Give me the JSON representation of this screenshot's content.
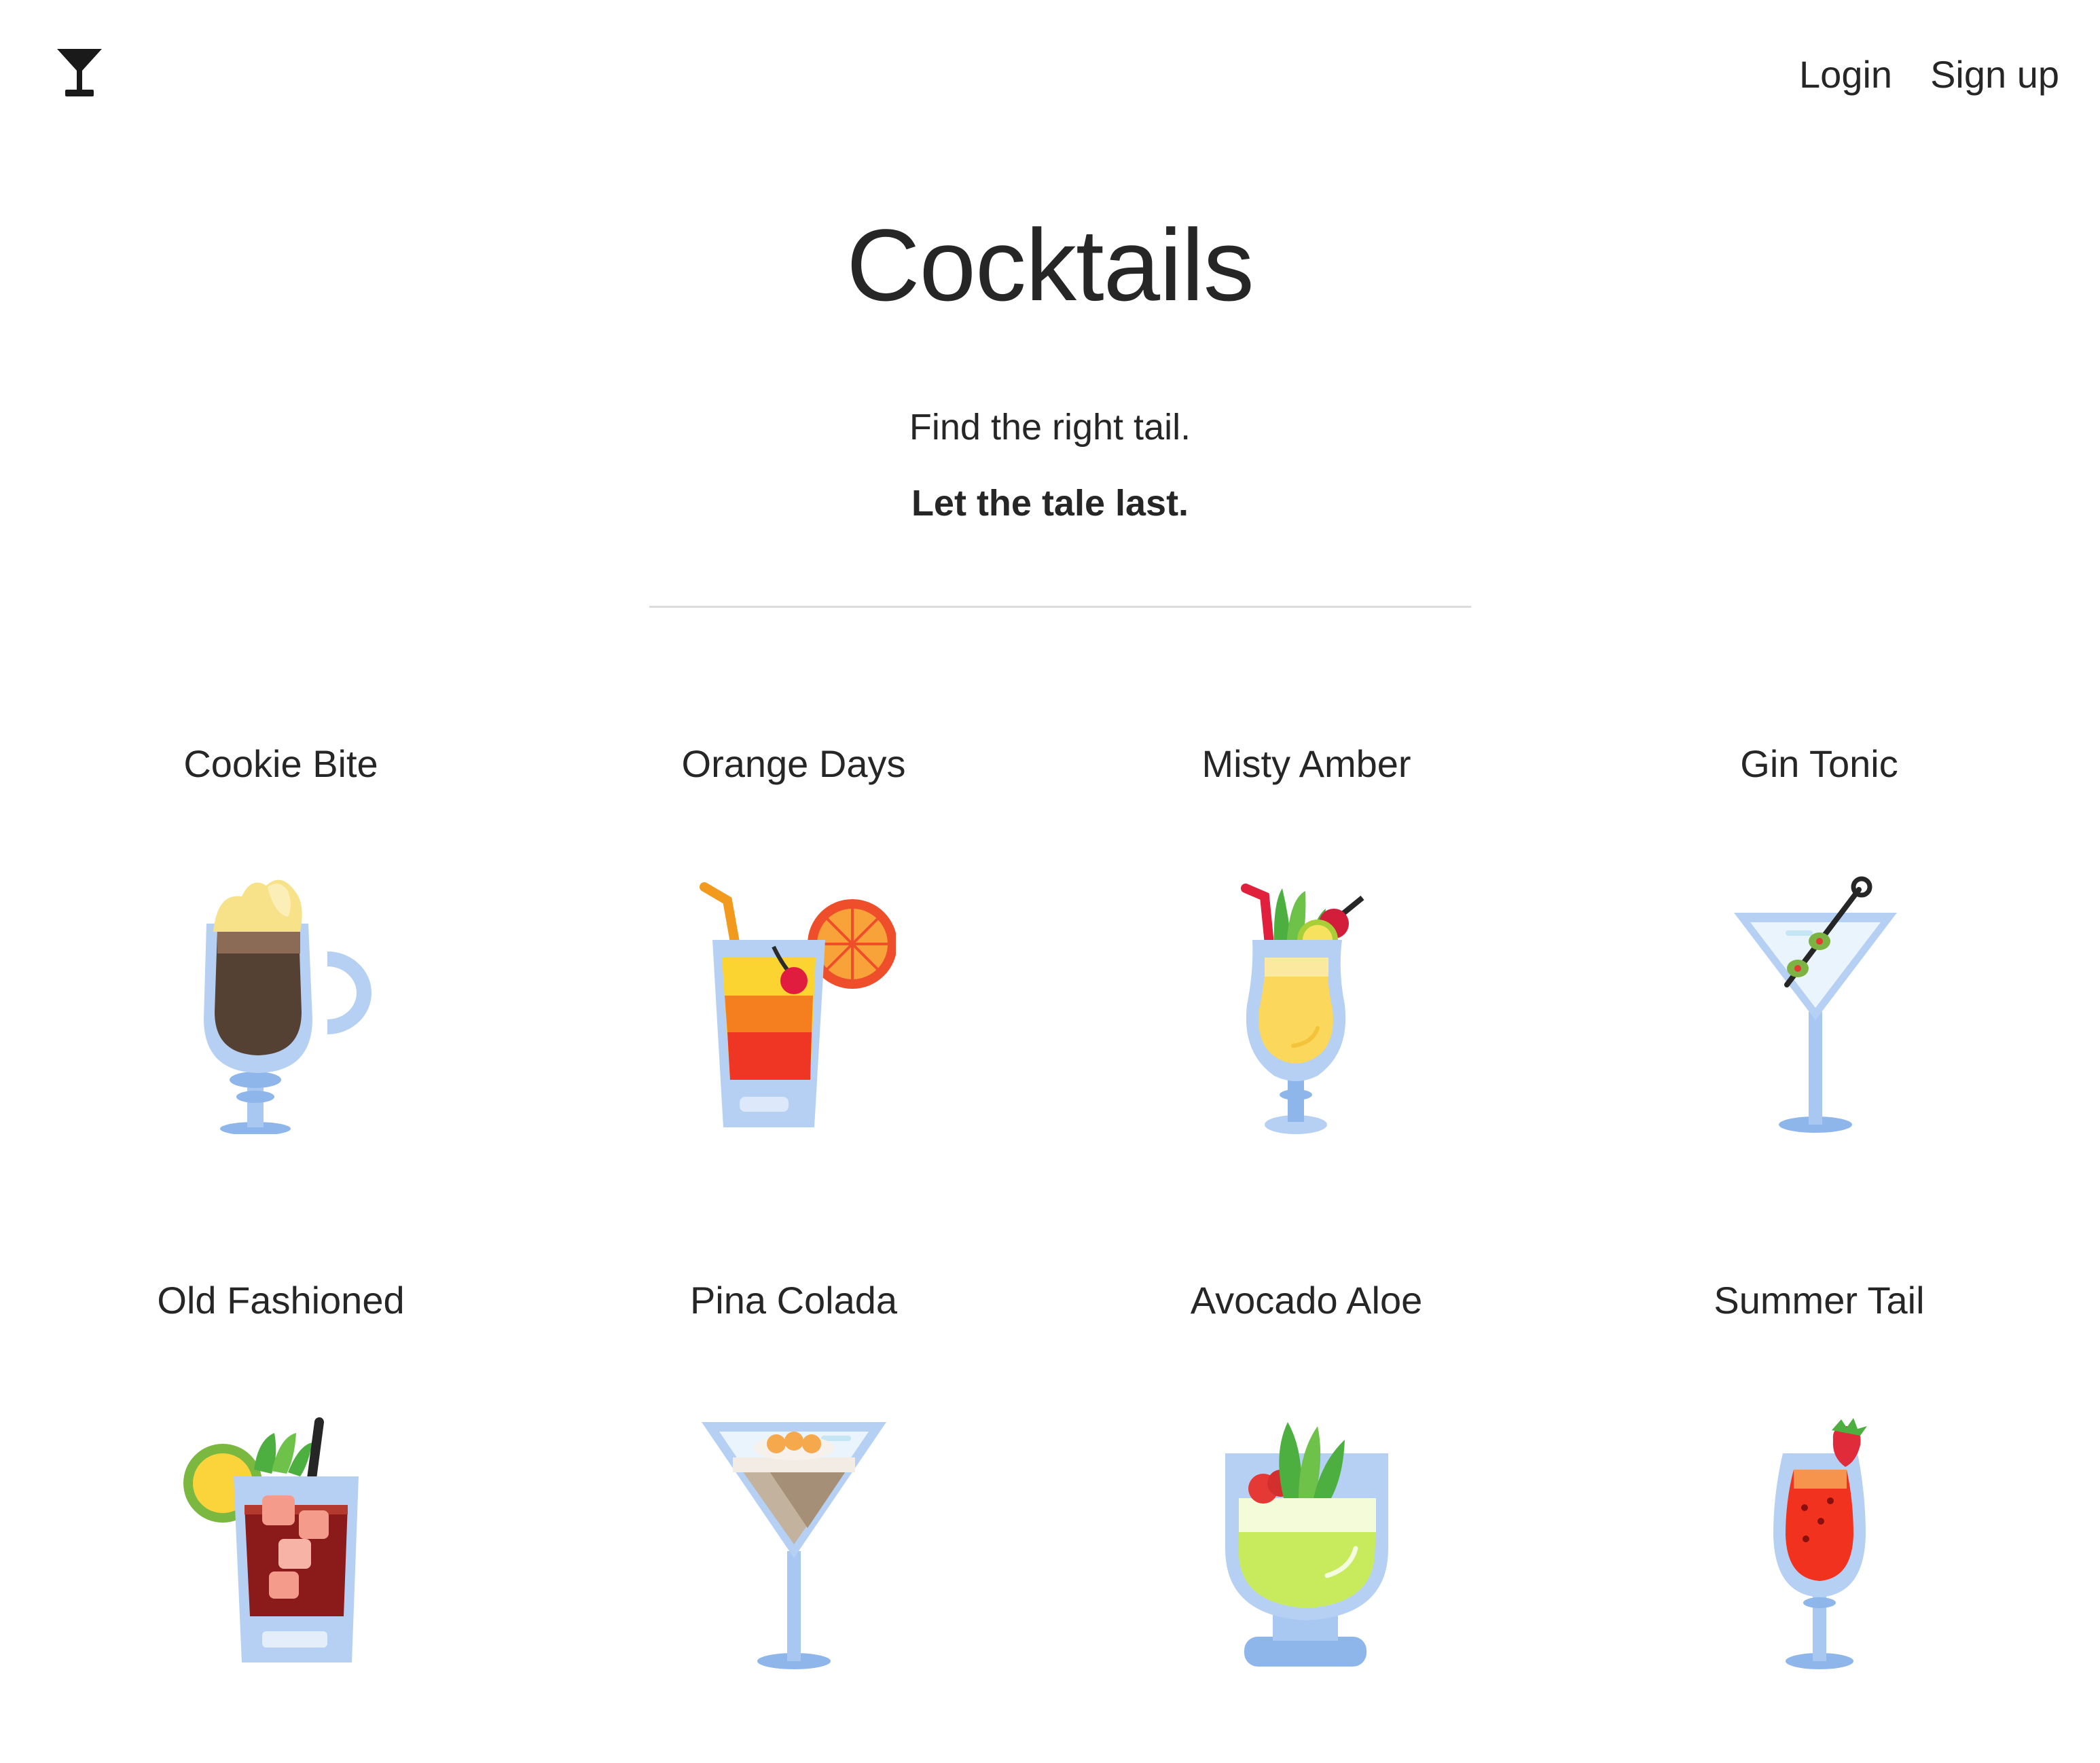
{
  "header": {
    "logo_icon": "cocktail-glass-icon",
    "nav": {
      "login": "Login",
      "signup": "Sign up"
    }
  },
  "hero": {
    "title": "Cocktails",
    "tagline_1": "Find the right tail.",
    "tagline_2": "Let the tale last."
  },
  "cocktails": [
    {
      "name": "Cookie Bite",
      "icon": "irish-coffee-icon"
    },
    {
      "name": "Orange Days",
      "icon": "orange-highball-icon"
    },
    {
      "name": "Misty Amber",
      "icon": "hurricane-glass-icon"
    },
    {
      "name": "Gin Tonic",
      "icon": "martini-olive-icon"
    },
    {
      "name": "Old Fashioned",
      "icon": "rocks-glass-icon"
    },
    {
      "name": "Pina Colada",
      "icon": "cream-martini-icon"
    },
    {
      "name": "Avocado Aloe",
      "icon": "aloe-bowl-icon"
    },
    {
      "name": "Summer Tail",
      "icon": "strawberry-tulip-icon"
    }
  ]
}
